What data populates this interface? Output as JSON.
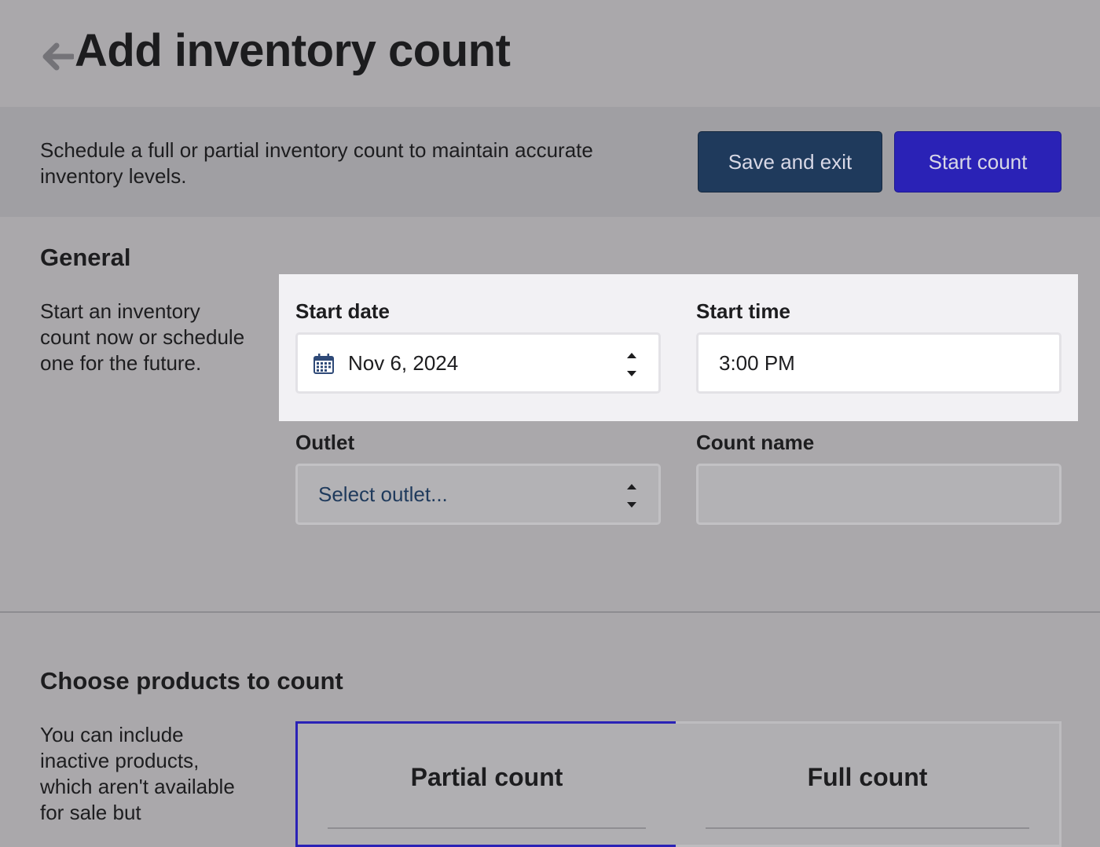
{
  "header": {
    "title": "Add inventory count"
  },
  "actionbar": {
    "description": "Schedule a full or partial inventory count to maintain accurate inventory levels.",
    "save_label": "Save and exit",
    "start_label": "Start count"
  },
  "general": {
    "title": "General",
    "description": "Start an inventory count now or schedule one for the future.",
    "start_date": {
      "label": "Start date",
      "value": "Nov 6, 2024"
    },
    "start_time": {
      "label": "Start time",
      "value": "3:00 PM"
    },
    "outlet": {
      "label": "Outlet",
      "placeholder": "Select outlet..."
    },
    "count_name": {
      "label": "Count name",
      "value": ""
    }
  },
  "products": {
    "title": "Choose products to count",
    "description": "You can include inactive products, which aren't available for sale but",
    "options": [
      {
        "label": "Partial count",
        "selected": true
      },
      {
        "label": "Full count",
        "selected": false
      }
    ]
  },
  "colors": {
    "primary": "#2a22b6",
    "secondary": "#1f3a5c",
    "placeholder_text": "#1f3a5c"
  }
}
